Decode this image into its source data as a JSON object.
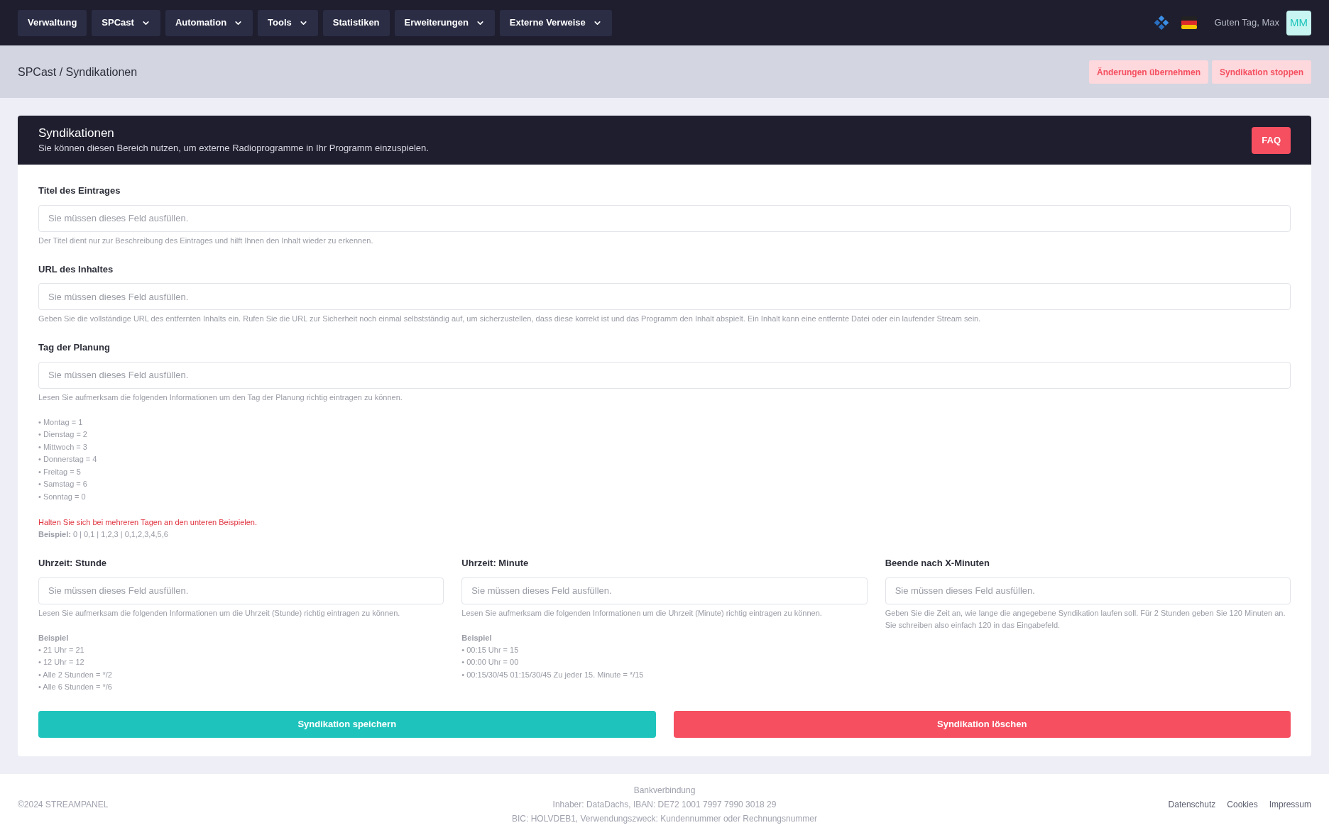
{
  "nav": {
    "items": [
      {
        "label": "Verwaltung",
        "dropdown": false
      },
      {
        "label": "SPCast",
        "dropdown": true
      },
      {
        "label": "Automation",
        "dropdown": true
      },
      {
        "label": "Tools",
        "dropdown": true
      },
      {
        "label": "Statistiken",
        "dropdown": false
      },
      {
        "label": "Erweiterungen",
        "dropdown": true
      },
      {
        "label": "Externe Verweise",
        "dropdown": true
      }
    ],
    "greeting": "Guten Tag, Max",
    "avatar": "MM"
  },
  "breadcrumb": "SPCast / Syndikationen",
  "header_actions": [
    "Änderungen übernehmen",
    "Syndikation stoppen"
  ],
  "card": {
    "title": "Syndikationen",
    "subtitle": "Sie können diesen Bereich nutzen, um externe Radioprogramme in Ihr Programm einzuspielen.",
    "faq": "FAQ"
  },
  "fields": [
    {
      "label": "Titel des Eintrages",
      "placeholder": "Sie müssen dieses Feld ausfüllen.",
      "help": "Der Titel dient nur zur Beschreibung des Eintrages und hilft Ihnen den Inhalt wieder zu erkennen."
    },
    {
      "label": "URL des Inhaltes",
      "placeholder": "Sie müssen dieses Feld ausfüllen.",
      "help": "Geben Sie die vollständige URL des entfernten Inhalts ein. Rufen Sie die URL zur Sicherheit noch einmal selbstständig auf, um sicherzustellen, dass diese korrekt ist und das Programm den Inhalt abspielt. Ein Inhalt kann eine entfernte Datei oder ein laufender Stream sein."
    },
    {
      "label": "Tag der Planung",
      "placeholder": "Sie müssen dieses Feld ausfüllen.",
      "help": "Lesen Sie aufmerksam die folgenden Informationen um den Tag der Planung richtig eintragen zu können.",
      "list": [
        "• Montag = 1",
        "• Dienstag = 2",
        "• Mittwoch = 3",
        "• Donnerstag = 4",
        "• Freitag = 5",
        "• Samstag = 6",
        "• Sonntag = 0"
      ],
      "warning": "Halten Sie sich bei mehreren Tagen an den unteren Beispielen.",
      "example": "**Beispiel:** 0 | 0,1 | 1,2,3 | 0,1,2,3,4,5,6"
    }
  ],
  "columns": [
    {
      "label": "Uhrzeit: Stunde",
      "placeholder": "Sie müssen dieses Feld ausfüllen.",
      "help": "Lesen Sie aufmerksam die folgenden Informationen um die Uhrzeit (Stunde) richtig eintragen zu können.",
      "example_title": "Beispiel",
      "list": [
        "• 21 Uhr = 21",
        "• 12 Uhr = 12",
        "• Alle 2 Stunden = */2",
        "• Alle 6 Stunden = */6"
      ]
    },
    {
      "label": "Uhrzeit: Minute",
      "placeholder": "Sie müssen dieses Feld ausfüllen.",
      "help": "Lesen Sie aufmerksam die folgenden Informationen um die Uhrzeit (Minute) richtig eintragen zu können.",
      "example_title": "Beispiel",
      "list": [
        "• 00:15 Uhr = 15",
        "• 00:00 Uhr = 00",
        "• 00:15/30/45 01:15/30/45 Zu jeder 15. Minute = */15"
      ]
    },
    {
      "label": "Beende nach X-Minuten",
      "placeholder": "Sie müssen dieses Feld ausfüllen.",
      "help": "Geben Sie die Zeit an, wie lange die angegebene Syndikation laufen soll. Für 2 Stunden geben Sie 120 Minuten an. Sie schreiben also einfach 120 in das Eingabefeld."
    }
  ],
  "buttons": [
    {
      "label": "Syndikation speichern",
      "kind": "save"
    },
    {
      "label": "Syndikation löschen",
      "kind": "delete"
    }
  ],
  "footer": {
    "copyright": "©2024 STREAMPANEL",
    "bank": [
      "Bankverbindung",
      "Inhaber: DataDachs, IBAN: DE72 1001 7997 7990 3018 29",
      "BIC: HOLVDEB1, Verwendungszweck: Kundennummer oder Rechnungsnummer"
    ],
    "links": [
      "Datenschutz",
      "Cookies",
      "Impressum"
    ]
  }
}
